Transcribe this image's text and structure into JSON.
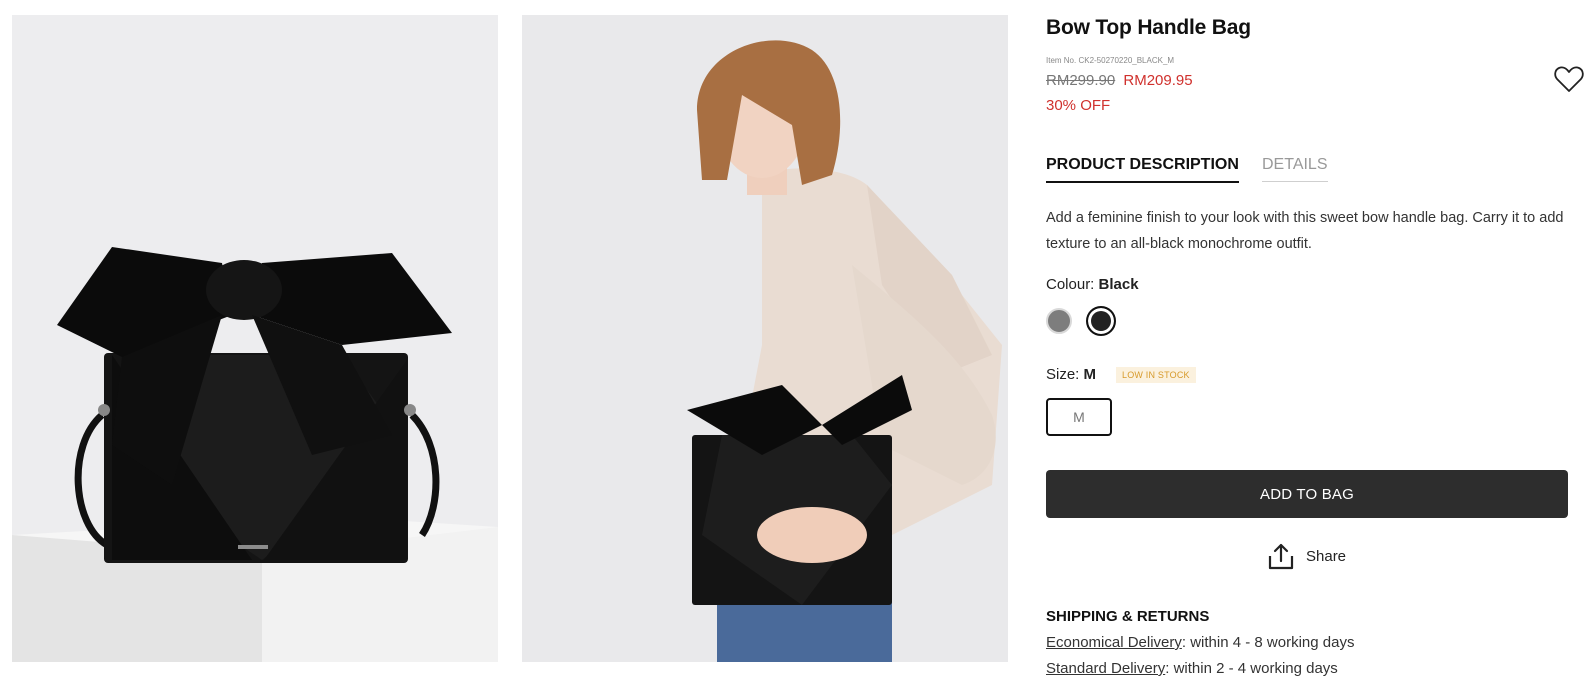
{
  "gallery": {
    "product_image": "bow-top-handle-bag-product-icon",
    "model_image": "bow-top-handle-bag-model-icon"
  },
  "product": {
    "title": "Bow Top Handle Bag",
    "item_no": "Item No. CK2-50270220_BLACK_M",
    "price_original": "RM299.90",
    "price_sale": "RM209.95",
    "discount": "30% OFF",
    "wishlist_icon": "heart-icon"
  },
  "tabs": {
    "description_label": "PRODUCT DESCRIPTION",
    "details_label": "DETAILS",
    "active": "PRODUCT DESCRIPTION"
  },
  "description": "Add a feminine finish to your look with this sweet bow handle bag. Carry it to add texture to an all-black monochrome outfit.",
  "colour": {
    "label": "Colour:",
    "selected": "Black",
    "swatches": [
      {
        "color": "#7d7d7d"
      },
      {
        "color": "#222222",
        "selected": true
      }
    ]
  },
  "size": {
    "label": "Size:",
    "selected": "M",
    "stock_badge": "LOW IN STOCK",
    "options": [
      "M"
    ]
  },
  "actions": {
    "add_to_bag": "ADD TO BAG",
    "share": "Share",
    "share_icon": "share-upload-icon"
  },
  "shipping": {
    "title": "SHIPPING & RETURNS",
    "lines": [
      {
        "method": "Economical Delivery",
        "text": ": within 4 - 8 working days"
      },
      {
        "method": "Standard Delivery",
        "text": ": within 2 - 4 working days"
      }
    ]
  },
  "colors": {
    "sale_red": "#d0312d",
    "button_dark": "#2d2d2d",
    "badge_bg": "#fbf1de",
    "badge_text": "#d79a2b"
  }
}
